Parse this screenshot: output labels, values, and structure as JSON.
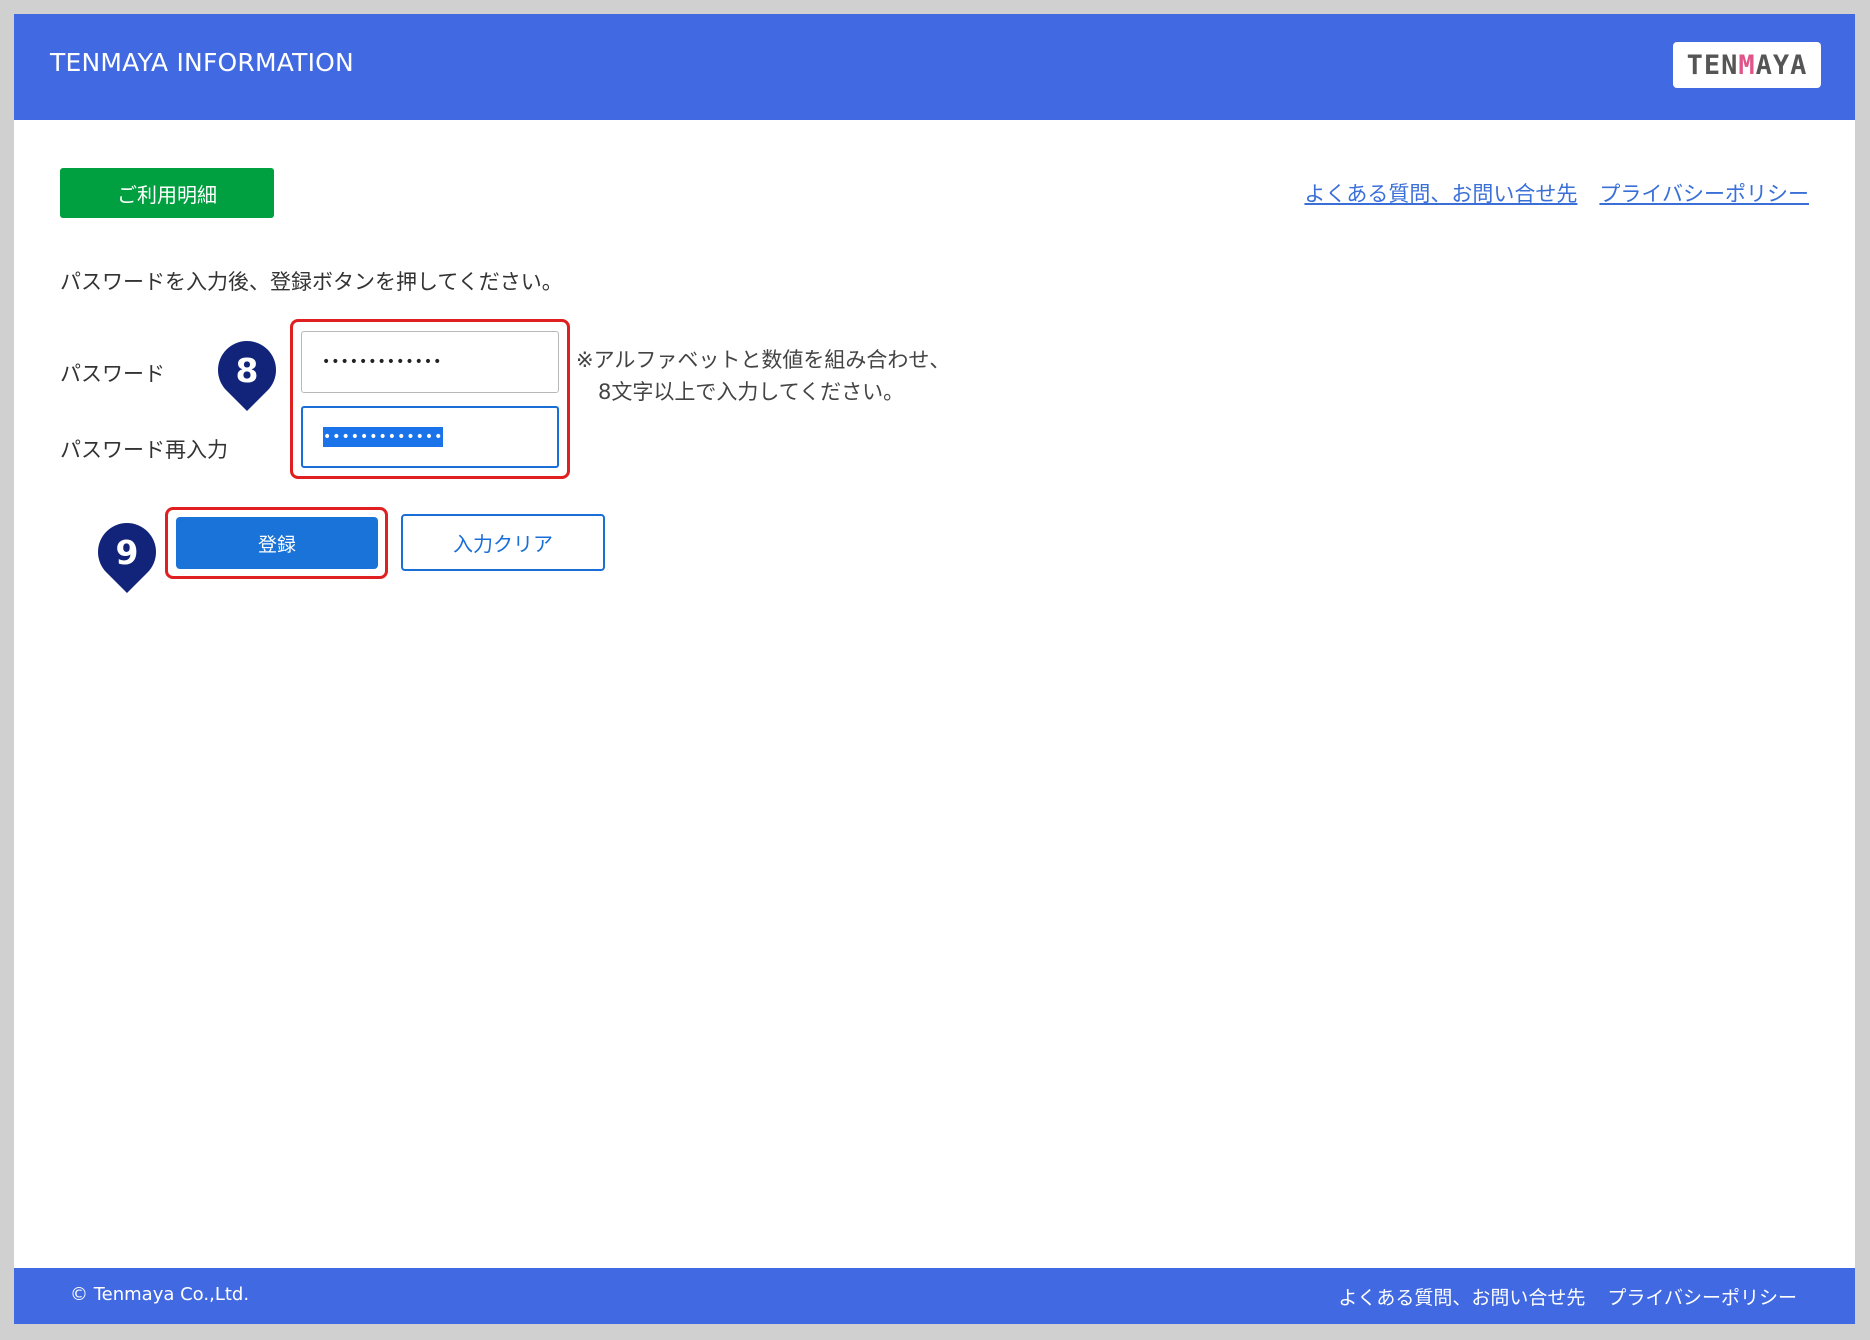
{
  "header": {
    "title": "TENMAYA INFORMATION",
    "logo_text": "TENMAYA"
  },
  "nav": {
    "statement_button": "ご利用明細",
    "faq_link": "よくある質問、お問い合せ先",
    "privacy_link": "プライバシーポリシー"
  },
  "form": {
    "instruction": "パスワードを入力後、登録ボタンを押してください。",
    "password_label": "パスワード",
    "password_value": "•••••••••••••",
    "password_confirm_label": "パスワード再入力",
    "password_confirm_value": "•••••••••••••",
    "note_line1": "※アルファベットと数値を組み合わせ、",
    "note_line2": "8文字以上で入力してください。",
    "register_button": "登録",
    "clear_button": "入力クリア"
  },
  "markers": {
    "step8": "8",
    "step9": "9"
  },
  "footer": {
    "copyright": "© Tenmaya Co.,Ltd.",
    "faq_link": "よくある質問、お問い合せ先",
    "privacy_link": "プライバシーポリシー"
  },
  "colors": {
    "header_bg": "#4169e1",
    "statement_button": "#00a040",
    "primary_button": "#1a73d8",
    "highlight_box": "#e02020",
    "marker": "#12237a"
  }
}
